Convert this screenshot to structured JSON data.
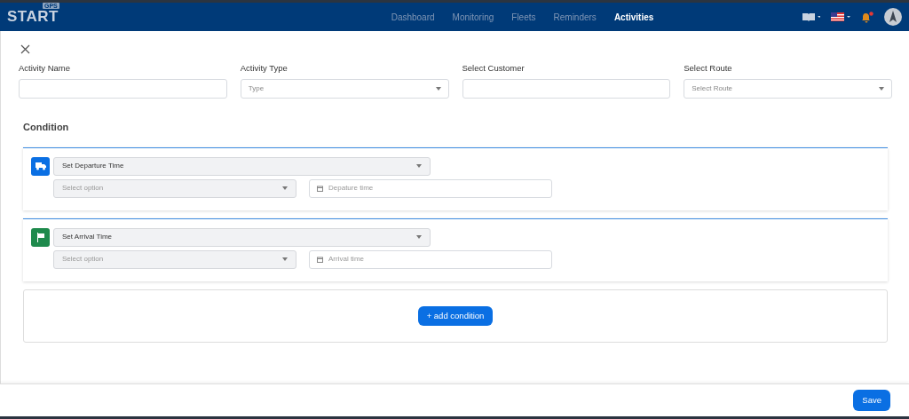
{
  "logo": {
    "text": "START",
    "badge": "GPS"
  },
  "nav": [
    {
      "label": "Dashboard",
      "selected": false
    },
    {
      "label": "Monitoring",
      "selected": false
    },
    {
      "label": "Fleets",
      "selected": false
    },
    {
      "label": "Reminders",
      "selected": false
    },
    {
      "label": "Activities",
      "selected": true
    }
  ],
  "notifications": {
    "unread": true
  },
  "fields": [
    {
      "label": "Activity Name",
      "kind": "text"
    },
    {
      "label": "Activity Type",
      "kind": "select",
      "placeholder": "Type"
    },
    {
      "label": "Select Customer",
      "kind": "text"
    },
    {
      "label": "Select Route",
      "kind": "select",
      "placeholder": "Select Route"
    }
  ],
  "condition": {
    "title": "Condition",
    "items": [
      {
        "kind": "departure",
        "event": "Set Departure Time",
        "option_placeholder": "Select option",
        "time_placeholder": "Depature time"
      },
      {
        "kind": "arrival",
        "event": "Set Arrival Time",
        "option_placeholder": "Select option",
        "time_placeholder": "Arrival time"
      }
    ],
    "add_button": "+ add condition"
  },
  "save_button": "Save"
}
